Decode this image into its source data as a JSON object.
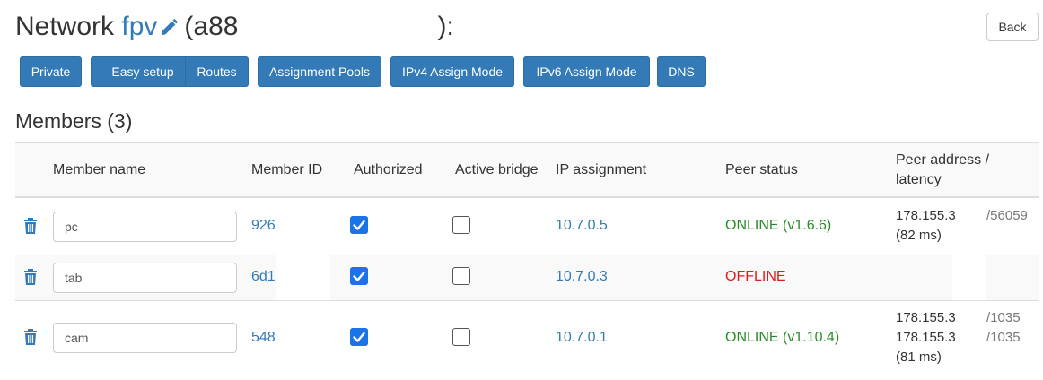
{
  "header": {
    "title_prefix": "Network",
    "network_name": "fpv",
    "id_open": "(a88",
    "id_close": "):",
    "back_label": "Back"
  },
  "toolbar": {
    "buttons": [
      {
        "label": "Private"
      },
      {
        "label": "Easy setup"
      },
      {
        "label": "Routes"
      },
      {
        "label": "Assignment Pools"
      },
      {
        "label": "IPv4 Assign Mode"
      },
      {
        "label": "IPv6 Assign Mode"
      },
      {
        "label": "DNS"
      }
    ]
  },
  "members": {
    "heading": "Members (3)",
    "columns": {
      "name": "Member name",
      "id": "Member ID",
      "authorized": "Authorized",
      "bridge": "Active bridge",
      "ip": "IP assignment",
      "status": "Peer status",
      "peer_line1": "Peer address /",
      "peer_line2": "latency"
    },
    "rows": [
      {
        "name": "pc",
        "id": "926",
        "authorized": true,
        "bridge": false,
        "ip": "10.7.0.5",
        "status": "ONLINE (v1.6.6)",
        "status_color": "#2b8a2b",
        "peer_lines": [
          "178.155.3",
          "(82 ms)"
        ],
        "peer_suffix": [
          "/56059"
        ]
      },
      {
        "name": "tab",
        "id": "6d1",
        "authorized": true,
        "bridge": false,
        "ip": "10.7.0.3",
        "status": "OFFLINE",
        "status_color": "#e01b1b",
        "peer_lines": [],
        "peer_suffix": []
      },
      {
        "name": "cam",
        "id": "548",
        "authorized": true,
        "bridge": false,
        "ip": "10.7.0.1",
        "status": "ONLINE (v1.10.4)",
        "status_color": "#2b8a2b",
        "peer_lines": [
          "178.155.3",
          "178.155.3",
          "(81 ms)"
        ],
        "peer_suffix": [
          "/1035",
          "/1035"
        ]
      }
    ]
  },
  "colors": {
    "primary": "#337ab7",
    "online": "#2b8a2b",
    "offline": "#e01b1b",
    "checkbox": "#1a73e8"
  },
  "icons": {
    "edit": "pencil-icon",
    "delete": "trash-icon",
    "check": "checkmark-icon"
  }
}
